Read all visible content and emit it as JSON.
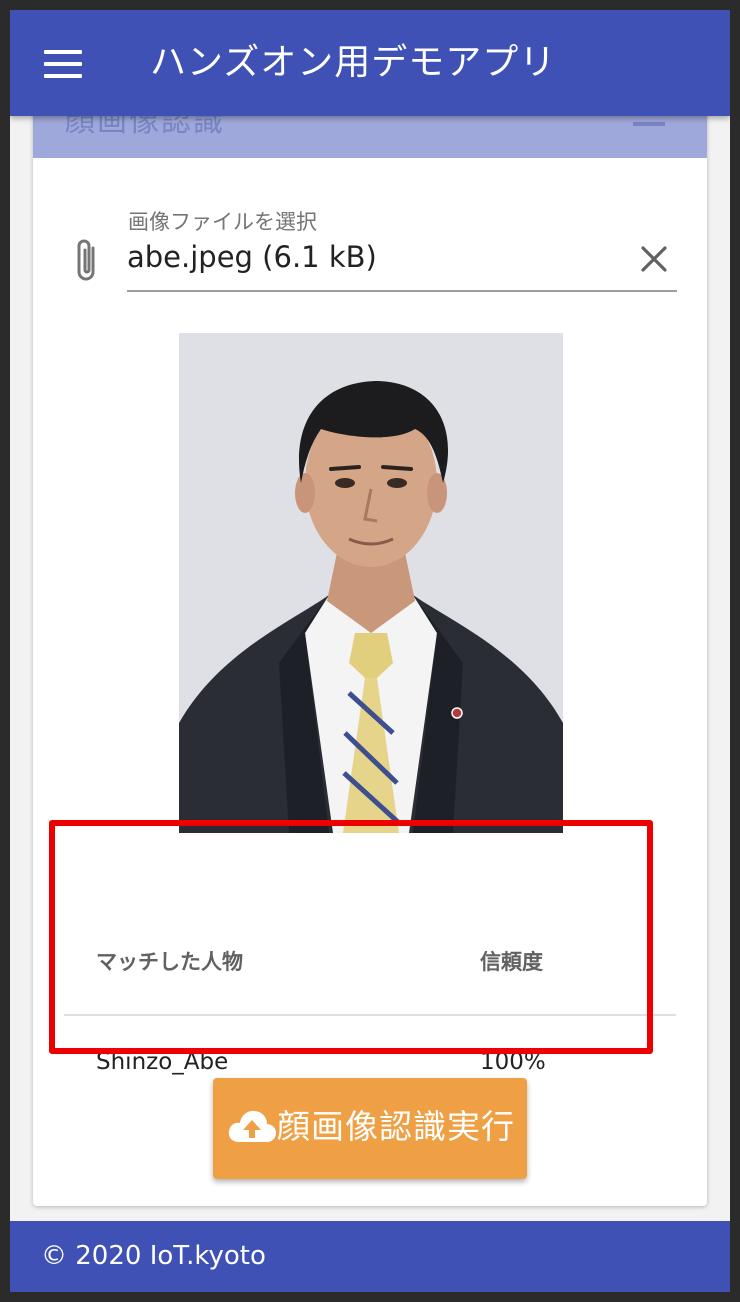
{
  "app": {
    "title": "ハンズオン用デモアプリ",
    "menu_icon": "menu-icon",
    "primary_color": "#3f51b5"
  },
  "card": {
    "header_title": "顔画像認識",
    "header_color": "#9fa8da"
  },
  "file_input": {
    "label": "画像ファイルを選択",
    "value": "abe.jpeg (6.1 kB)",
    "prefix_icon": "paperclip-icon",
    "clear_icon": "close-icon"
  },
  "results": {
    "headers": [
      "マッチした人物",
      "信頼度"
    ],
    "rows": [
      [
        "Shinzo_Abe",
        "100%"
      ]
    ],
    "highlight_color": "#ee0000"
  },
  "action": {
    "label": "顔画像認識実行",
    "icon": "cloud-upload-icon",
    "color": "#f0a044"
  },
  "footer": {
    "text": "© 2020 IoT.kyoto"
  }
}
